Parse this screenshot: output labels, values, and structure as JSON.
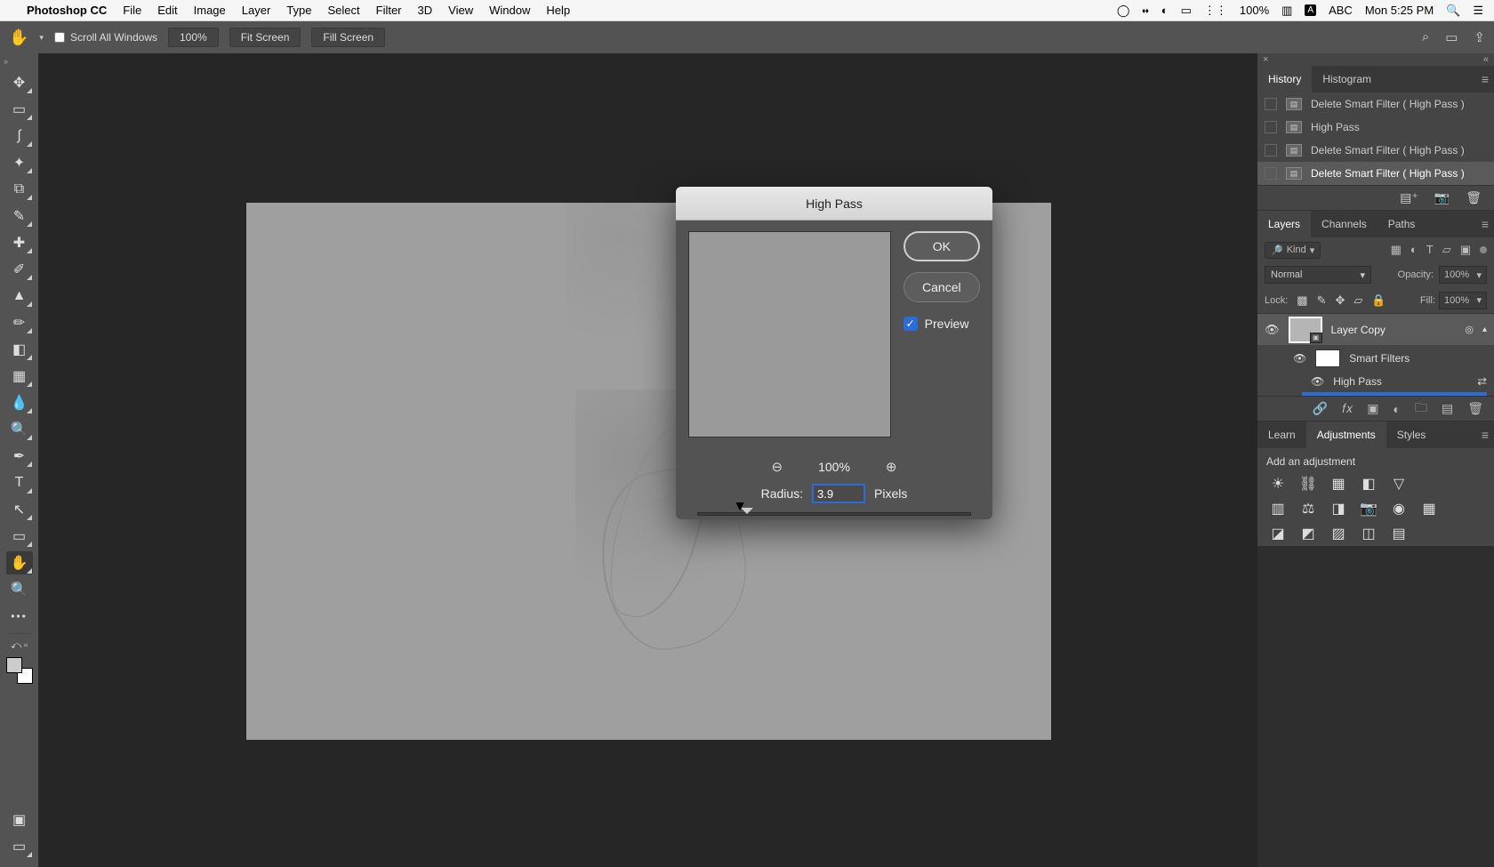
{
  "menubar": {
    "app": "Photoshop CC",
    "items": [
      "File",
      "Edit",
      "Image",
      "Layer",
      "Type",
      "Select",
      "Filter",
      "3D",
      "View",
      "Window",
      "Help"
    ],
    "battery": "100%",
    "input_mode": "ABC",
    "clock": "Mon 5:25 PM"
  },
  "options": {
    "scroll_all": "Scroll All Windows",
    "zoom": "100%",
    "fit": "Fit Screen",
    "fill": "Fill Screen"
  },
  "dialog": {
    "title": "High Pass",
    "ok": "OK",
    "cancel": "Cancel",
    "preview": "Preview",
    "preview_checked": true,
    "zoom": "100%",
    "radius_label": "Radius:",
    "radius_value": "3.9",
    "radius_units": "Pixels"
  },
  "panels": {
    "history": {
      "tabs": [
        "History",
        "Histogram"
      ],
      "active_tab": 0,
      "items": [
        "Delete Smart Filter ( High Pass )",
        "High Pass",
        "Delete Smart Filter ( High Pass )",
        "Delete Smart Filter ( High Pass )"
      ],
      "selected": 3
    },
    "layers": {
      "tabs": [
        "Layers",
        "Channels",
        "Paths"
      ],
      "active_tab": 0,
      "kind": "Kind",
      "blend": "Normal",
      "opacity_label": "Opacity:",
      "opacity": "100%",
      "lock_label": "Lock:",
      "fill_label": "Fill:",
      "fill": "100%",
      "layer_name": "Layer Copy",
      "smart_filters": "Smart Filters",
      "filter_name": "High Pass"
    },
    "adjustments": {
      "tabs": [
        "Learn",
        "Adjustments",
        "Styles"
      ],
      "active_tab": 1,
      "title": "Add an adjustment"
    }
  }
}
